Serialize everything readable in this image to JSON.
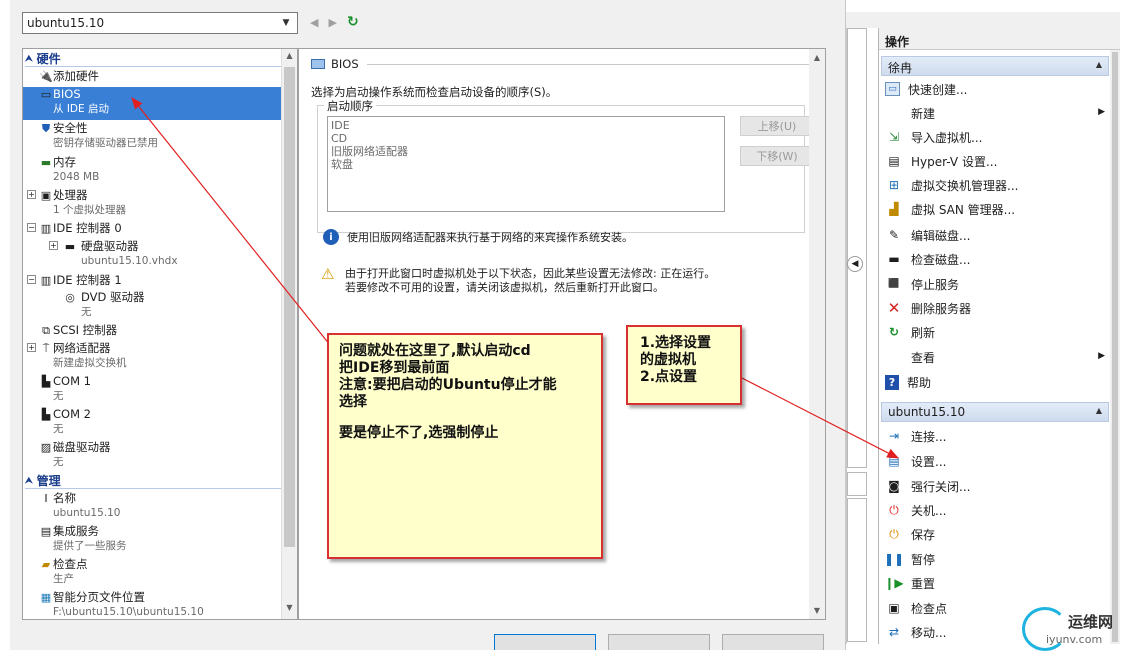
{
  "dialog": {
    "vm_select": "ubuntu15.10",
    "nav_back": "◀",
    "nav_fwd": "▶",
    "refresh": "↻"
  },
  "tree": {
    "hardware_section": "硬件",
    "manage_section": "管理",
    "items": [
      {
        "title": "添加硬件",
        "sub": ""
      },
      {
        "title": "BIOS",
        "sub": "从 IDE 启动"
      },
      {
        "title": "安全性",
        "sub": "密钥存储驱动器已禁用"
      },
      {
        "title": "内存",
        "sub": "2048 MB"
      },
      {
        "title": "处理器",
        "sub": "1 个虚拟处理器"
      },
      {
        "title": "IDE 控制器 0",
        "sub": ""
      },
      {
        "title": "硬盘驱动器",
        "sub": "ubuntu15.10.vhdx"
      },
      {
        "title": "IDE 控制器 1",
        "sub": ""
      },
      {
        "title": "DVD 驱动器",
        "sub": "无"
      },
      {
        "title": "SCSI 控制器",
        "sub": ""
      },
      {
        "title": "网络适配器",
        "sub": "新建虚拟交换机"
      },
      {
        "title": "COM 1",
        "sub": "无"
      },
      {
        "title": "COM 2",
        "sub": "无"
      },
      {
        "title": "磁盘驱动器",
        "sub": "无"
      }
    ],
    "manage_items": [
      {
        "title": "名称",
        "sub": "ubuntu15.10"
      },
      {
        "title": "集成服务",
        "sub": "提供了一些服务"
      },
      {
        "title": "检查点",
        "sub": "生产"
      },
      {
        "title": "智能分页文件位置",
        "sub": "F:\\ubuntu15.10\\ubuntu15.10"
      }
    ]
  },
  "panel": {
    "title": "BIOS",
    "description": "选择为启动操作系统而检查启动设备的顺序(S)。",
    "boot_order_label": "启动顺序",
    "boot_order": [
      "IDE",
      "CD",
      "旧版网络适配器",
      "软盘"
    ],
    "move_up": "上移(U)",
    "move_down": "下移(W)",
    "info_text": "使用旧版网络适配器来执行基于网络的来宾操作系统安装。",
    "warning_line1": "由于打开此窗口时虚拟机处于以下状态，因此某些设置无法修改: 正在运行。",
    "warning_line2": "若要修改不可用的设置，请关闭该虚拟机，然后重新打开此窗口。"
  },
  "actions": {
    "header": "操作",
    "server_group": "徐冉",
    "server_items": [
      {
        "label": "快速创建...",
        "icon": "quick-create-icon"
      },
      {
        "label": "新建",
        "icon": "new-icon"
      },
      {
        "label": "导入虚拟机...",
        "icon": "import-icon"
      },
      {
        "label": "Hyper-V 设置...",
        "icon": "settings-icon"
      },
      {
        "label": "虚拟交换机管理器...",
        "icon": "switch-icon"
      },
      {
        "label": "虚拟 SAN 管理器...",
        "icon": "san-icon"
      },
      {
        "label": "编辑磁盘...",
        "icon": "edit-disk-icon"
      },
      {
        "label": "检查磁盘...",
        "icon": "inspect-disk-icon"
      },
      {
        "label": "停止服务",
        "icon": "stop-service-icon"
      },
      {
        "label": "删除服务器",
        "icon": "delete-icon"
      },
      {
        "label": "刷新",
        "icon": "refresh-icon"
      },
      {
        "label": "查看",
        "icon": ""
      },
      {
        "label": "帮助",
        "icon": "help-icon"
      }
    ],
    "vm_group": "ubuntu15.10",
    "vm_items": [
      {
        "label": "连接...",
        "icon": "connect-icon"
      },
      {
        "label": "设置...",
        "icon": "vm-settings-icon"
      },
      {
        "label": "强行关闭...",
        "icon": "turn-off-icon"
      },
      {
        "label": "关机...",
        "icon": "shutdown-icon"
      },
      {
        "label": "保存",
        "icon": "save-icon"
      },
      {
        "label": "暂停",
        "icon": "pause-icon"
      },
      {
        "label": "重置",
        "icon": "reset-icon"
      },
      {
        "label": "检查点",
        "icon": "checkpoint-icon"
      },
      {
        "label": "移动...",
        "icon": "move-icon"
      }
    ]
  },
  "notes": {
    "left_line1": "问题就处在这里了,默认启动cd",
    "left_line2": "把IDE移到最前面",
    "left_line3": "注意:要把启动的Ubuntu停止才能",
    "left_line4": "选择",
    "left_line5": "要是停止不了,选强制停止",
    "right_line1": "1.选择设置",
    "right_line2": "的虚拟机",
    "right_line3": "2.点设置"
  },
  "watermark": {
    "name": "运维网",
    "url": "iyunv.com"
  },
  "colors": {
    "selection": "#3a7fd6",
    "note_bg": "#ffffcc",
    "note_border": "#d83030",
    "arrow": "#e02020"
  }
}
